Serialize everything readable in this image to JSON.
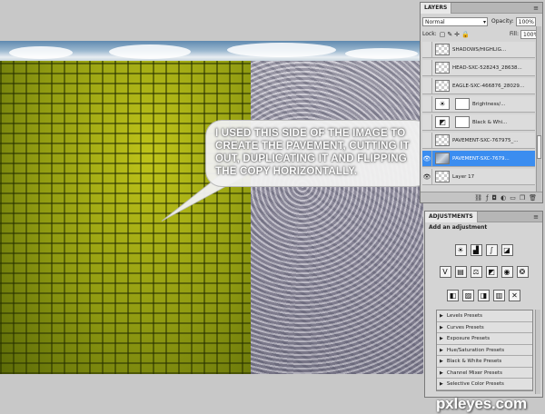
{
  "canvas": {
    "callout_text": "I USED THIS SIDE OF THE IMAGE TO CREATE THE PAVEMENT, CUTTING IT OUT, DUPLICATING IT AND FLIPPING THE COPY HORIZONTALLY."
  },
  "layers_panel": {
    "tab": "LAYERS",
    "blend_mode": "Normal",
    "opacity_label": "Opacity:",
    "opacity_value": "100%",
    "lock_label": "Lock:",
    "fill_label": "Fill:",
    "fill_value": "100%",
    "layers": [
      {
        "name": "SHADOWS/HIGHLIG...",
        "thumb": "pattern",
        "visible": false
      },
      {
        "name": "HEAD-SXC-528243_28638...",
        "thumb": "pattern",
        "visible": false
      },
      {
        "name": "EAGLE-SXC-466876_28029...",
        "thumb": "pattern",
        "visible": false
      },
      {
        "name": "Brightness/...",
        "thumb": "brightness-icon",
        "visible": false
      },
      {
        "name": "Black & Whi...",
        "thumb": "black-white-icon",
        "visible": false
      },
      {
        "name": "PAVEMENT-SXC-767975_...",
        "thumb": "pattern",
        "visible": false
      },
      {
        "name": "PAVEMENT-SXC-7679...",
        "thumb": "photo",
        "visible": true,
        "selected": true
      },
      {
        "name": "Layer 17",
        "thumb": "pattern",
        "visible": true
      }
    ]
  },
  "adjustments_panel": {
    "tab": "ADJUSTMENTS",
    "title": "Add an adjustment",
    "icon_rows": [
      [
        "brightness-icon",
        "levels-icon",
        "curves-icon",
        "exposure-icon"
      ],
      [
        "vibrance-icon",
        "hue-saturation-icon",
        "color-balance-icon",
        "black-white-icon",
        "photo-filter-icon",
        "channel-mixer-icon"
      ],
      [
        "invert-icon",
        "posterize-icon",
        "threshold-icon",
        "gradient-map-icon",
        "selective-color-icon"
      ]
    ],
    "presets": [
      "Levels Presets",
      "Curves Presets",
      "Exposure Presets",
      "Hue/Saturation Presets",
      "Black & White Presets",
      "Channel Mixer Presets",
      "Selective Color Presets"
    ]
  },
  "watermark": "pxleyes.com",
  "colors": {
    "selection": "#3b8df0",
    "panel_bg": "#d4d4d4",
    "pavement_left": "#9aa314"
  }
}
